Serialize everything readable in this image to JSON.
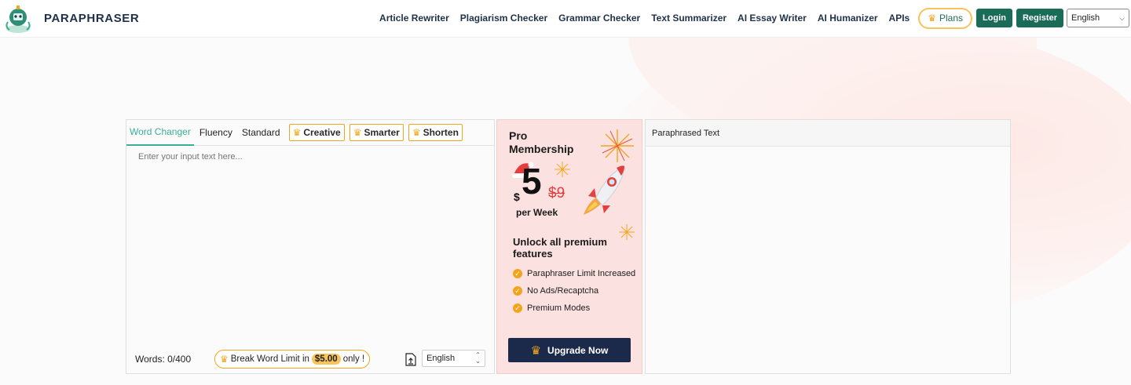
{
  "header": {
    "brand": "PARAPHRASER",
    "nav": [
      {
        "label": "Article Rewriter"
      },
      {
        "label": "Plagiarism Checker"
      },
      {
        "label": "Grammar Checker"
      },
      {
        "label": "Text Summarizer"
      },
      {
        "label": "AI Essay Writer"
      },
      {
        "label": "AI Humanizer"
      },
      {
        "label": "APIs"
      }
    ],
    "plans_label": "Plans",
    "login_label": "Login",
    "register_label": "Register",
    "language": "English"
  },
  "tool": {
    "tabs": {
      "word_changer": "Word Changer",
      "fluency": "Fluency",
      "standard": "Standard",
      "creative": "Creative",
      "smarter": "Smarter",
      "shorten": "Shorten"
    },
    "input_placeholder": "Enter your input text here...",
    "word_count": "Words: 0/400",
    "break_limit_prefix": "Break Word Limit in",
    "break_limit_price": "$5.00",
    "break_limit_suffix": "only !",
    "input_language": "English",
    "output_title": "Paraphrased Text"
  },
  "promo": {
    "title": "Pro Membership",
    "price_symbol": "$",
    "price": "5",
    "old_price": "$9",
    "period": "per Week",
    "unlock": "Unlock all premium features",
    "features": [
      "Paraphraser Limit Increased",
      "No Ads/Recaptcha",
      "Premium Modes"
    ],
    "cta": "Upgrade Now"
  },
  "colors": {
    "accent": "#1a6b58",
    "tab_active": "#3bae95",
    "gold": "#f2a51c",
    "promo_bg": "#fbe2e0",
    "cta_bg": "#1b2a4a"
  }
}
